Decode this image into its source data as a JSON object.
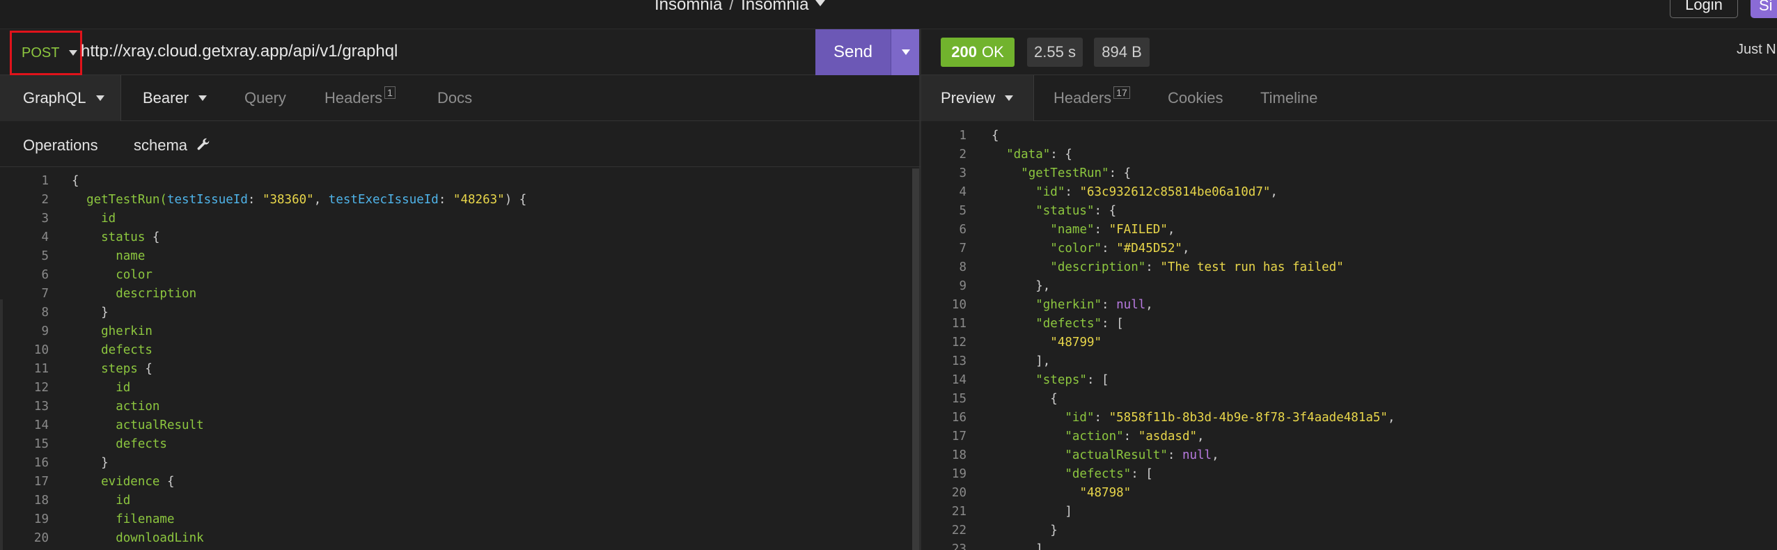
{
  "titlebar": {
    "workspace": "Insomnia",
    "separator": "/",
    "project": "Insomnia",
    "login_label": "Login",
    "signup_label": "Si"
  },
  "request": {
    "method": "POST",
    "url": "http://xray.cloud.getxray.app/api/v1/graphql",
    "send_label": "Send"
  },
  "response": {
    "status_code": "200",
    "status_text": "OK",
    "time": "2.55 s",
    "size": "894 B",
    "timestamp": "Just N"
  },
  "left_tabs": [
    {
      "label": "GraphQL"
    },
    {
      "label": "Bearer"
    },
    {
      "label": "Query"
    },
    {
      "label": "Headers",
      "count": "1"
    },
    {
      "label": "Docs"
    }
  ],
  "sub_tabs": {
    "operations": "Operations",
    "schema": "schema"
  },
  "right_tabs": [
    {
      "label": "Preview"
    },
    {
      "label": "Headers",
      "count": "17"
    },
    {
      "label": "Cookies"
    },
    {
      "label": "Timeline"
    }
  ],
  "colors": {
    "accent": "#6c58b6",
    "method": "#8dc73f",
    "ok": "#71b32d",
    "highlight_box": "#e0131b"
  },
  "query_lines": [
    {
      "n": "1",
      "t": [
        [
          "{",
          "brace"
        ]
      ]
    },
    {
      "n": "2",
      "t": [
        [
          "  getTestRun(",
          "field"
        ],
        [
          "testIssueId",
          "arg"
        ],
        [
          ": ",
          "brace"
        ],
        [
          "\"38360\"",
          "str"
        ],
        [
          ", ",
          "brace"
        ],
        [
          "testExecIssueId",
          "arg"
        ],
        [
          ": ",
          "brace"
        ],
        [
          "\"48263\"",
          "str"
        ],
        [
          ") {",
          "brace"
        ]
      ]
    },
    {
      "n": "3",
      "t": [
        [
          "    id",
          "field"
        ]
      ]
    },
    {
      "n": "4",
      "t": [
        [
          "    status",
          "field"
        ],
        [
          " {",
          "brace"
        ]
      ]
    },
    {
      "n": "5",
      "t": [
        [
          "      name",
          "field"
        ]
      ]
    },
    {
      "n": "6",
      "t": [
        [
          "      color",
          "field"
        ]
      ]
    },
    {
      "n": "7",
      "t": [
        [
          "      description",
          "field"
        ]
      ]
    },
    {
      "n": "8",
      "t": [
        [
          "    }",
          "brace"
        ]
      ]
    },
    {
      "n": "9",
      "t": [
        [
          "    gherkin",
          "field"
        ]
      ]
    },
    {
      "n": "10",
      "t": [
        [
          "    defects",
          "field"
        ]
      ]
    },
    {
      "n": "11",
      "t": [
        [
          "    steps",
          "field"
        ],
        [
          " {",
          "brace"
        ]
      ]
    },
    {
      "n": "12",
      "t": [
        [
          "      id",
          "field"
        ]
      ]
    },
    {
      "n": "13",
      "t": [
        [
          "      action",
          "field"
        ]
      ]
    },
    {
      "n": "14",
      "t": [
        [
          "      actualResult",
          "field"
        ]
      ]
    },
    {
      "n": "15",
      "t": [
        [
          "      defects",
          "field"
        ]
      ]
    },
    {
      "n": "16",
      "t": [
        [
          "    }",
          "brace"
        ]
      ]
    },
    {
      "n": "17",
      "t": [
        [
          "    evidence",
          "field"
        ],
        [
          " {",
          "brace"
        ]
      ]
    },
    {
      "n": "18",
      "t": [
        [
          "      id",
          "field"
        ]
      ]
    },
    {
      "n": "19",
      "t": [
        [
          "      filename",
          "field"
        ]
      ]
    },
    {
      "n": "20",
      "t": [
        [
          "      downloadLink",
          "field"
        ]
      ]
    }
  ],
  "response_lines": [
    {
      "n": "1",
      "t": [
        [
          "{",
          "brace"
        ]
      ]
    },
    {
      "n": "2",
      "t": [
        [
          "  ",
          "brace"
        ],
        [
          "\"data\"",
          "key"
        ],
        [
          ": {",
          "brace"
        ]
      ]
    },
    {
      "n": "3",
      "t": [
        [
          "    ",
          "brace"
        ],
        [
          "\"getTestRun\"",
          "key"
        ],
        [
          ": {",
          "brace"
        ]
      ]
    },
    {
      "n": "4",
      "t": [
        [
          "      ",
          "brace"
        ],
        [
          "\"id\"",
          "key"
        ],
        [
          ": ",
          "brace"
        ],
        [
          "\"63c932612c85814be06a10d7\"",
          "str"
        ],
        [
          ",",
          "brace"
        ]
      ]
    },
    {
      "n": "5",
      "t": [
        [
          "      ",
          "brace"
        ],
        [
          "\"status\"",
          "key"
        ],
        [
          ": {",
          "brace"
        ]
      ]
    },
    {
      "n": "6",
      "t": [
        [
          "        ",
          "brace"
        ],
        [
          "\"name\"",
          "key"
        ],
        [
          ": ",
          "brace"
        ],
        [
          "\"FAILED\"",
          "str"
        ],
        [
          ",",
          "brace"
        ]
      ]
    },
    {
      "n": "7",
      "t": [
        [
          "        ",
          "brace"
        ],
        [
          "\"color\"",
          "key"
        ],
        [
          ": ",
          "brace"
        ],
        [
          "\"#D45D52\"",
          "str"
        ],
        [
          ",",
          "brace"
        ]
      ]
    },
    {
      "n": "8",
      "t": [
        [
          "        ",
          "brace"
        ],
        [
          "\"description\"",
          "key"
        ],
        [
          ": ",
          "brace"
        ],
        [
          "\"The test run has failed\"",
          "str"
        ]
      ]
    },
    {
      "n": "9",
      "t": [
        [
          "      },",
          "brace"
        ]
      ]
    },
    {
      "n": "10",
      "t": [
        [
          "      ",
          "brace"
        ],
        [
          "\"gherkin\"",
          "key"
        ],
        [
          ": ",
          "brace"
        ],
        [
          "null",
          "null"
        ],
        [
          ",",
          "brace"
        ]
      ]
    },
    {
      "n": "11",
      "t": [
        [
          "      ",
          "brace"
        ],
        [
          "\"defects\"",
          "key"
        ],
        [
          ": [",
          "brace"
        ]
      ]
    },
    {
      "n": "12",
      "t": [
        [
          "        ",
          "brace"
        ],
        [
          "\"48799\"",
          "str"
        ]
      ]
    },
    {
      "n": "13",
      "t": [
        [
          "      ],",
          "brace"
        ]
      ]
    },
    {
      "n": "14",
      "t": [
        [
          "      ",
          "brace"
        ],
        [
          "\"steps\"",
          "key"
        ],
        [
          ": [",
          "brace"
        ]
      ]
    },
    {
      "n": "15",
      "t": [
        [
          "        {",
          "brace"
        ]
      ]
    },
    {
      "n": "16",
      "t": [
        [
          "          ",
          "brace"
        ],
        [
          "\"id\"",
          "key"
        ],
        [
          ": ",
          "brace"
        ],
        [
          "\"5858f11b-8b3d-4b9e-8f78-3f4aade481a5\"",
          "str"
        ],
        [
          ",",
          "brace"
        ]
      ]
    },
    {
      "n": "17",
      "t": [
        [
          "          ",
          "brace"
        ],
        [
          "\"action\"",
          "key"
        ],
        [
          ": ",
          "brace"
        ],
        [
          "\"asdasd\"",
          "str"
        ],
        [
          ",",
          "brace"
        ]
      ]
    },
    {
      "n": "18",
      "t": [
        [
          "          ",
          "brace"
        ],
        [
          "\"actualResult\"",
          "key"
        ],
        [
          ": ",
          "brace"
        ],
        [
          "null",
          "null"
        ],
        [
          ",",
          "brace"
        ]
      ]
    },
    {
      "n": "19",
      "t": [
        [
          "          ",
          "brace"
        ],
        [
          "\"defects\"",
          "key"
        ],
        [
          ": [",
          "brace"
        ]
      ]
    },
    {
      "n": "20",
      "t": [
        [
          "            ",
          "brace"
        ],
        [
          "\"48798\"",
          "str"
        ]
      ]
    },
    {
      "n": "21",
      "t": [
        [
          "          ]",
          "brace"
        ]
      ]
    },
    {
      "n": "22",
      "t": [
        [
          "        }",
          "brace"
        ]
      ]
    },
    {
      "n": "23",
      "t": [
        [
          "      ]",
          "brace"
        ]
      ]
    }
  ]
}
